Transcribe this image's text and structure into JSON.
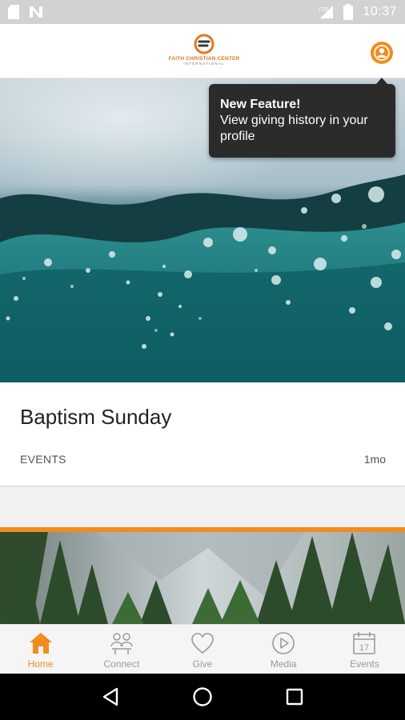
{
  "status_bar": {
    "time": "10:37",
    "network_label": "LTE",
    "icons": [
      "sd-card-icon",
      "n-notification-icon",
      "signal-icon",
      "battery-icon"
    ]
  },
  "header": {
    "logo": {
      "name": "FAITH CHRISTIAN CENTER",
      "subtitle": "INTERNATIONAL"
    },
    "profile_icon": "user-icon"
  },
  "tooltip": {
    "title": "New Feature!",
    "body": "View giving history in your profile"
  },
  "feed": {
    "items": [
      {
        "title": "Baptism Sunday",
        "category": "EVENTS",
        "age": "1mo",
        "image": "underwater-bubbles"
      },
      {
        "image": "forest-mountains"
      }
    ]
  },
  "bottom_nav": {
    "items": [
      {
        "label": "Home",
        "icon": "home-icon",
        "active": true
      },
      {
        "label": "Connect",
        "icon": "people-icon",
        "active": false
      },
      {
        "label": "Give",
        "icon": "heart-icon",
        "active": false
      },
      {
        "label": "Media",
        "icon": "play-icon",
        "active": false
      },
      {
        "label": "Events",
        "icon": "calendar-icon",
        "active": false
      }
    ],
    "calendar_day": "17"
  },
  "colors": {
    "accent": "#f28c1e",
    "tooltip_bg": "#2b2b2b",
    "status_bar": "#d2d2d2"
  }
}
